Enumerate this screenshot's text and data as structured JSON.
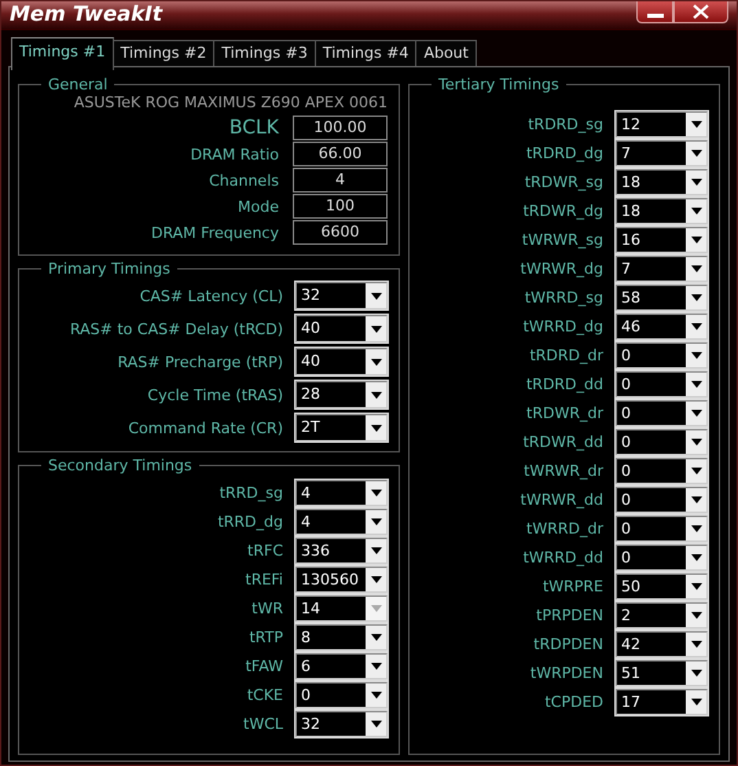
{
  "window": {
    "title": "Mem TweakIt"
  },
  "tabs": [
    {
      "label": "Timings #1",
      "selected": true
    },
    {
      "label": "Timings #2",
      "selected": false
    },
    {
      "label": "Timings #3",
      "selected": false
    },
    {
      "label": "Timings #4",
      "selected": false
    },
    {
      "label": "About",
      "selected": false
    }
  ],
  "general": {
    "title": "General",
    "board": "ASUSTeK ROG MAXIMUS Z690 APEX 0061",
    "fields": [
      {
        "label": "BCLK",
        "value": "100.00",
        "kind": "large"
      },
      {
        "label": "DRAM Ratio",
        "value": "66.00",
        "kind": "normal"
      },
      {
        "label": "Channels",
        "value": "4",
        "kind": "normal"
      },
      {
        "label": "Mode",
        "value": "100",
        "kind": "normal"
      },
      {
        "label": "DRAM Frequency",
        "value": "6600",
        "kind": "normal"
      }
    ]
  },
  "primary": {
    "title": "Primary Timings",
    "items": [
      {
        "label": "CAS# Latency (CL)",
        "value": "32",
        "disabled": false
      },
      {
        "label": "RAS# to CAS# Delay (tRCD)",
        "value": "40",
        "disabled": false
      },
      {
        "label": "RAS# Precharge (tRP)",
        "value": "40",
        "disabled": false
      },
      {
        "label": "Cycle Time (tRAS)",
        "value": "28",
        "disabled": false
      },
      {
        "label": "Command Rate (CR)",
        "value": "2T",
        "disabled": false
      }
    ]
  },
  "secondary": {
    "title": "Secondary Timings",
    "items": [
      {
        "label": "tRRD_sg",
        "value": "4",
        "disabled": false
      },
      {
        "label": "tRRD_dg",
        "value": "4",
        "disabled": false
      },
      {
        "label": "tRFC",
        "value": "336",
        "disabled": false
      },
      {
        "label": "tREFi",
        "value": "130560",
        "disabled": false
      },
      {
        "label": "tWR",
        "value": "14",
        "disabled": true
      },
      {
        "label": "tRTP",
        "value": "8",
        "disabled": false
      },
      {
        "label": "tFAW",
        "value": "6",
        "disabled": false
      },
      {
        "label": "tCKE",
        "value": "0",
        "disabled": false
      },
      {
        "label": "tWCL",
        "value": "32",
        "disabled": false
      }
    ]
  },
  "tertiary": {
    "title": "Tertiary Timings",
    "items": [
      {
        "label": "tRDRD_sg",
        "value": "12",
        "disabled": false
      },
      {
        "label": "tRDRD_dg",
        "value": "7",
        "disabled": false
      },
      {
        "label": "tRDWR_sg",
        "value": "18",
        "disabled": false
      },
      {
        "label": "tRDWR_dg",
        "value": "18",
        "disabled": false
      },
      {
        "label": "tWRWR_sg",
        "value": "16",
        "disabled": false
      },
      {
        "label": "tWRWR_dg",
        "value": "7",
        "disabled": false
      },
      {
        "label": "tWRRD_sg",
        "value": "58",
        "disabled": false
      },
      {
        "label": "tWRRD_dg",
        "value": "46",
        "disabled": false
      },
      {
        "label": "tRDRD_dr",
        "value": "0",
        "disabled": false
      },
      {
        "label": "tRDRD_dd",
        "value": "0",
        "disabled": false
      },
      {
        "label": "tRDWR_dr",
        "value": "0",
        "disabled": false
      },
      {
        "label": "tRDWR_dd",
        "value": "0",
        "disabled": false
      },
      {
        "label": "tWRWR_dr",
        "value": "0",
        "disabled": false
      },
      {
        "label": "tWRWR_dd",
        "value": "0",
        "disabled": false
      },
      {
        "label": "tWRRD_dr",
        "value": "0",
        "disabled": false
      },
      {
        "label": "tWRRD_dd",
        "value": "0",
        "disabled": false
      },
      {
        "label": "tWRPRE",
        "value": "50",
        "disabled": false
      },
      {
        "label": "tPRPDEN",
        "value": "2",
        "disabled": false
      },
      {
        "label": "tRDPDEN",
        "value": "42",
        "disabled": false
      },
      {
        "label": "tWRPDEN",
        "value": "51",
        "disabled": false
      },
      {
        "label": "tCPDED",
        "value": "17",
        "disabled": false
      }
    ]
  }
}
